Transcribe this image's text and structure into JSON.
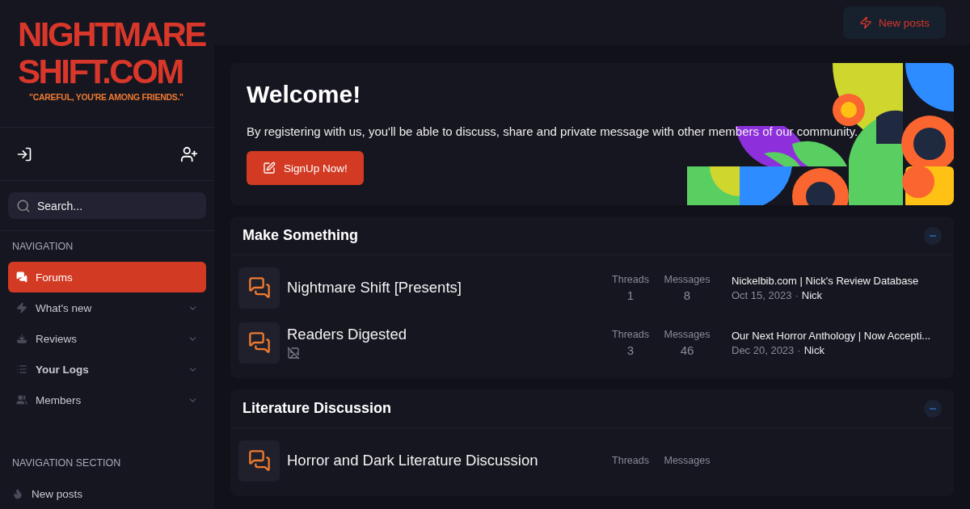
{
  "logo": {
    "line1": "NIGHTMARE",
    "line2": "SHIFT.COM",
    "tagline": "\"CAREFUL, YOU'RE AMONG FRIENDS.\""
  },
  "search": {
    "placeholder": "Search..."
  },
  "navigation": {
    "heading": "NAVIGATION",
    "items": [
      {
        "label": "Forums",
        "selected": true,
        "bold": false,
        "expandable": false
      },
      {
        "label": "What's new",
        "selected": false,
        "bold": false,
        "expandable": true
      },
      {
        "label": "Reviews",
        "selected": false,
        "bold": false,
        "expandable": true
      },
      {
        "label": "Your Logs",
        "selected": false,
        "bold": true,
        "expandable": true
      },
      {
        "label": "Members",
        "selected": false,
        "bold": false,
        "expandable": true
      }
    ]
  },
  "navigation_section": {
    "heading": "NAVIGATION SECTION",
    "items": [
      {
        "label": "New posts"
      }
    ]
  },
  "header": {
    "new_posts_button": "New posts"
  },
  "welcome": {
    "title": "Welcome!",
    "text": "By registering with us, you'll be able to discuss, share and private message with other members of our community.",
    "button": "SignUp Now!"
  },
  "categories": [
    {
      "title": "Make Something",
      "expanded": true,
      "forums": [
        {
          "name": "Nightmare Shift [Presents]",
          "threads_label": "Threads",
          "threads": "1",
          "messages_label": "Messages",
          "messages": "8",
          "latest_title": "Nickelbib.com | Nick's Review Database",
          "latest_date": "Oct 15, 2023",
          "separator": "·",
          "latest_user": "Nick",
          "broken_image": false
        },
        {
          "name": "Readers Digested",
          "threads_label": "Threads",
          "threads": "3",
          "messages_label": "Messages",
          "messages": "46",
          "latest_title": "Our Next Horror Anthology | Now Accepti...",
          "latest_date": "Dec 20, 2023",
          "separator": "·",
          "latest_user": "Nick",
          "broken_image": true
        }
      ]
    },
    {
      "title": "Literature Discussion",
      "expanded": true,
      "forums": [
        {
          "name": "Horror and Dark Literature Discussion",
          "threads_label": "Threads",
          "messages_label": "Messages",
          "broken_image": false
        }
      ]
    }
  ]
}
